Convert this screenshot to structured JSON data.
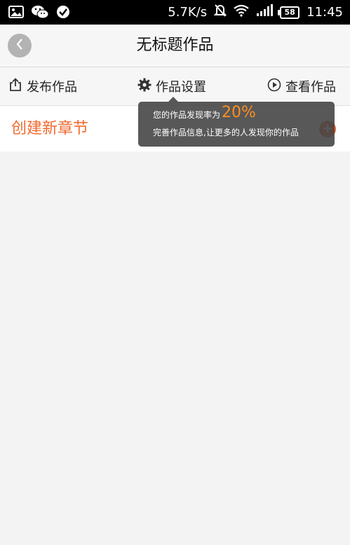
{
  "status_bar": {
    "speed": "5.7K/s",
    "battery": "58",
    "time": "11:45"
  },
  "header": {
    "title": "无标题作品"
  },
  "toolbar": {
    "publish_label": "发布作品",
    "settings_label": "作品设置",
    "view_label": "查看作品"
  },
  "content": {
    "create_chapter_label": "创建新章节"
  },
  "tooltip": {
    "line1_prefix": "您的作品发现率为",
    "percent": "20%",
    "line2": "完善作品信息,让更多的人发现你的作品"
  },
  "colors": {
    "accent": "#f26a2f",
    "percent": "#ff8f1f",
    "background": "#f3f3f3"
  }
}
